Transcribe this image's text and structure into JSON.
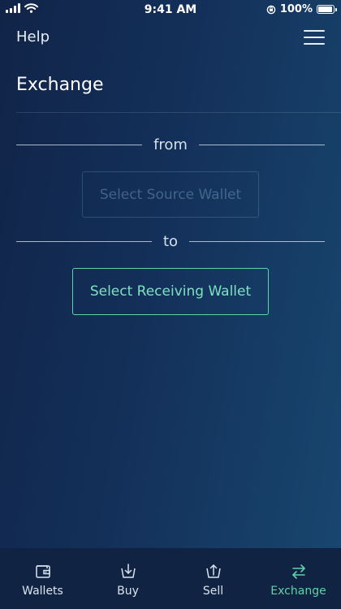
{
  "status_bar": {
    "time": "9:41 AM",
    "battery_text": "100%",
    "battery_level": 1.0
  },
  "header": {
    "help_label": "Help",
    "menu_icon": "hamburger-menu-icon"
  },
  "page": {
    "title": "Exchange"
  },
  "exchange": {
    "from_label": "from",
    "to_label": "to",
    "source_button_label": "Select Source Wallet",
    "receive_button_label": "Select Receiving Wallet"
  },
  "tabs": [
    {
      "label": "Wallets",
      "icon": "wallet-icon",
      "active": false
    },
    {
      "label": "Buy",
      "icon": "buy-icon",
      "active": false
    },
    {
      "label": "Sell",
      "icon": "sell-icon",
      "active": false
    },
    {
      "label": "Exchange",
      "icon": "exchange-arrows-icon",
      "active": true
    }
  ],
  "colors": {
    "accent": "#5fd3a8",
    "background_start": "#112448",
    "background_end": "#18476f",
    "tab_bar": "#102342"
  }
}
